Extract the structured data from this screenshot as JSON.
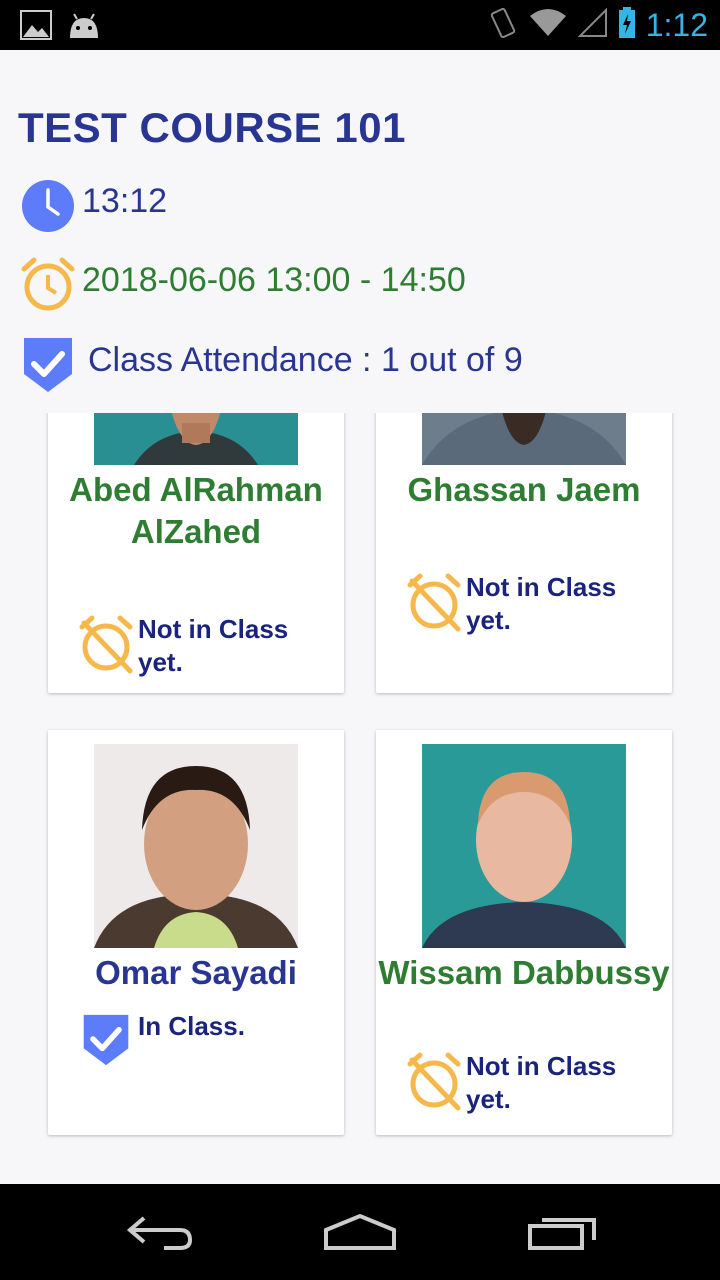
{
  "status_bar": {
    "time": "1:12",
    "left_icons": [
      "gallery-icon",
      "android-icon"
    ],
    "right_icons": [
      "vibrate-icon",
      "wifi-icon",
      "signal-icon",
      "battery-charging-icon"
    ]
  },
  "course": {
    "title": "TEST COURSE 101",
    "current_time": "13:12",
    "schedule": "2018-06-06  13:00 - 14:50",
    "attendance": "Class Attendance : 1 out of 9"
  },
  "students": [
    {
      "name": "Abed AlRahman AlZahed",
      "status": "Not in Class yet.",
      "in_class": false
    },
    {
      "name": "Ghassan Jaem",
      "status": "Not in Class yet.",
      "in_class": false
    },
    {
      "name": "Omar Sayadi",
      "status": "In Class.",
      "in_class": true
    },
    {
      "name": "Wissam Dabbussy",
      "status": "Not in Class yet.",
      "in_class": false
    }
  ],
  "colors": {
    "title_blue": "#283593",
    "green": "#2e7d32",
    "clock_blue": "#5c7cfa",
    "alarm_orange": "#f7b84b",
    "status_accent": "#33b5e5"
  },
  "nav_bar": [
    "back-icon",
    "home-icon",
    "recents-icon"
  ]
}
